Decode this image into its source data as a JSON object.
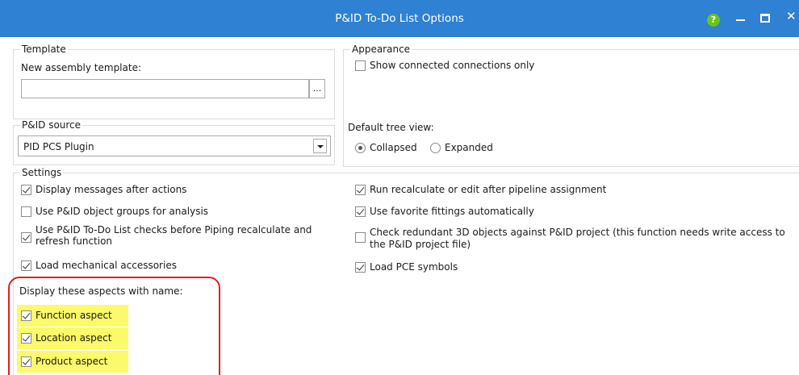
{
  "window": {
    "title": "P&ID To-Do List Options",
    "help_glyph": "?",
    "close_glyph": "✕"
  },
  "template": {
    "legend": "Template",
    "new_assembly_label": "New assembly template:",
    "new_assembly_value": "",
    "browse_label": "..."
  },
  "pid_source": {
    "legend": "P&ID source",
    "value": "PID PCS Plugin"
  },
  "appearance": {
    "legend": "Appearance",
    "show_connected_label": "Show connected connections only",
    "show_connected_checked": false,
    "default_tree_label": "Default tree view:",
    "collapsed_label": "Collapsed",
    "expanded_label": "Expanded",
    "selected": "Collapsed"
  },
  "settings": {
    "legend": "Settings",
    "left": [
      {
        "label": "Display messages after actions",
        "checked": true
      },
      {
        "label": "Use P&ID object groups for analysis",
        "checked": false
      },
      {
        "label": "Use P&ID To-Do List checks before Piping recalculate and refresh function",
        "line1": "Use P&ID To-Do List checks before Piping recalculate and",
        "line2": "refresh function",
        "checked": true
      },
      {
        "label": "Load mechanical accessories",
        "checked": true
      }
    ],
    "right": [
      {
        "label": "Run recalculate or edit after pipeline assignment",
        "checked": true
      },
      {
        "label": "Use favorite fittings automatically",
        "checked": true
      },
      {
        "label": "Check redundant 3D objects against P&ID project (this function needs write access to the P&ID project file)",
        "line1": "Check redundant 3D objects against P&ID project (this function needs write access to",
        "line2": "the P&ID project file)",
        "checked": false
      },
      {
        "label": "Load PCE symbols",
        "checked": true
      }
    ],
    "aspects_label": "Display these aspects with name:",
    "aspects": [
      {
        "label": "Function aspect",
        "checked": true
      },
      {
        "label": "Location aspect",
        "checked": true
      },
      {
        "label": "Product aspect",
        "checked": true
      }
    ]
  },
  "colors": {
    "titlebar": "#2e81d3",
    "highlight": "#fafa6a",
    "annotation": "#e02020",
    "help_icon": "#6cc417"
  }
}
